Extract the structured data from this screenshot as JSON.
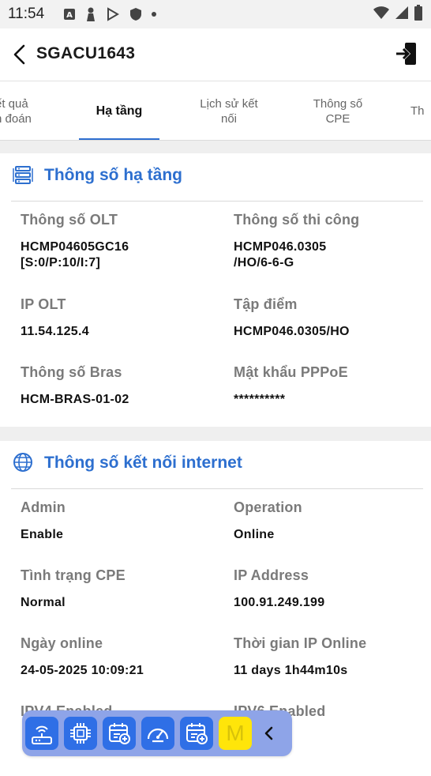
{
  "status_bar": {
    "time": "11:54",
    "icons": [
      "a-box-icon",
      "person-icon",
      "play-store-icon",
      "shield-icon",
      "dot-icon"
    ],
    "right_icons": [
      "wifi-icon",
      "signal-icon",
      "battery-icon"
    ]
  },
  "app_bar": {
    "title": "SGACU1643",
    "back_icon": "chevron-left-icon",
    "logout_icon": "logout-icon"
  },
  "tabs": [
    {
      "label": "ết quả\nn đoán",
      "active": false
    },
    {
      "label": "Hạ tầng",
      "active": true
    },
    {
      "label": "Lịch sử kết\nnối",
      "active": false
    },
    {
      "label": "Thông số\nCPE",
      "active": false
    },
    {
      "label": "Th",
      "active": false
    }
  ],
  "infrastructure": {
    "title": "Thông số hạ tầng",
    "icon": "server-rack-icon",
    "fields": [
      {
        "label": "Thông số OLT",
        "value": "HCMP04605GC16\n[S:0/P:10/I:7]"
      },
      {
        "label": "Thông số thi công",
        "value": "HCMP046.0305\n/HO/6-6-G"
      },
      {
        "label": "IP OLT",
        "value": "11.54.125.4"
      },
      {
        "label": "Tập điểm",
        "value": "HCMP046.0305/HO"
      },
      {
        "label": "Thông số Bras",
        "value": "HCM-BRAS-01-02"
      },
      {
        "label": "Mật khẩu PPPoE",
        "value": "**********"
      }
    ]
  },
  "internet": {
    "title": "Thông số kết nối internet",
    "icon": "globe-icon",
    "fields": [
      {
        "label": "Admin",
        "value": "Enable"
      },
      {
        "label": "Operation",
        "value": "Online"
      },
      {
        "label": "Tình trạng CPE",
        "value": "Normal"
      },
      {
        "label": "IP Address",
        "value": "100.91.249.199"
      },
      {
        "label": "Ngày online",
        "value": "24-05-2025 10:09:21"
      },
      {
        "label": "Thời gian IP Online",
        "value": "11 days 1h44m10s"
      },
      {
        "label": "IPV4 Enabled",
        "value": ""
      },
      {
        "label": "IPV6 Enabled",
        "value": ""
      }
    ]
  },
  "toolbar": {
    "buttons": [
      "router-icon",
      "chip-icon",
      "calendar-add-icon",
      "speedometer-icon",
      "calendar-add-icon"
    ],
    "m_label": "M",
    "collapse_icon": "chevron-left-icon"
  },
  "colors": {
    "accent": "#2d6fcf",
    "toolbar_bg": "#8ea4e8",
    "toolbar_button": "#2f6fe6",
    "m_button": "#ffe50a"
  }
}
